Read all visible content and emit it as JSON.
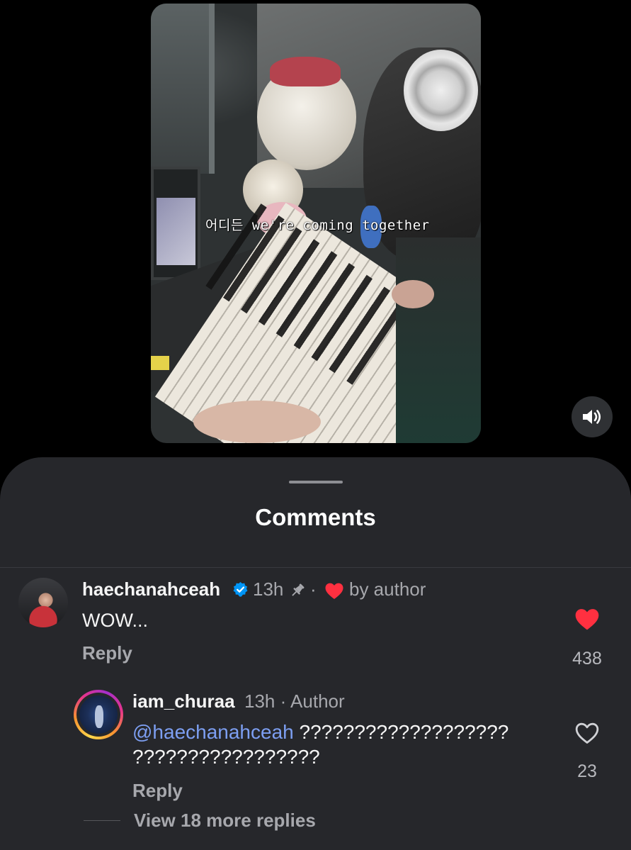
{
  "video": {
    "caption": "어디든 we're coming together",
    "sound_icon": "speaker-volume-icon"
  },
  "sheet": {
    "title": "Comments"
  },
  "comments": [
    {
      "username": "haechanahceah",
      "verified": true,
      "time": "13h",
      "pinned": true,
      "separator": "·",
      "liked_by_author_label": "by author",
      "text": "WOW...",
      "reply_label": "Reply",
      "like_count": "438",
      "liked": true
    },
    {
      "username": "iam_churaa",
      "meta": "13h · Author",
      "mention": "@haechanahceah",
      "text_line1": " ???????????????????",
      "text_line2": "?????????????????",
      "reply_label": "Reply",
      "like_count": "23",
      "liked": false
    }
  ],
  "view_more_replies": "View 18 more replies",
  "colors": {
    "sheet_bg": "#26272b",
    "heart_red": "#ff3040",
    "verified_blue": "#0095f6",
    "mention_blue": "#7d9ff2"
  }
}
